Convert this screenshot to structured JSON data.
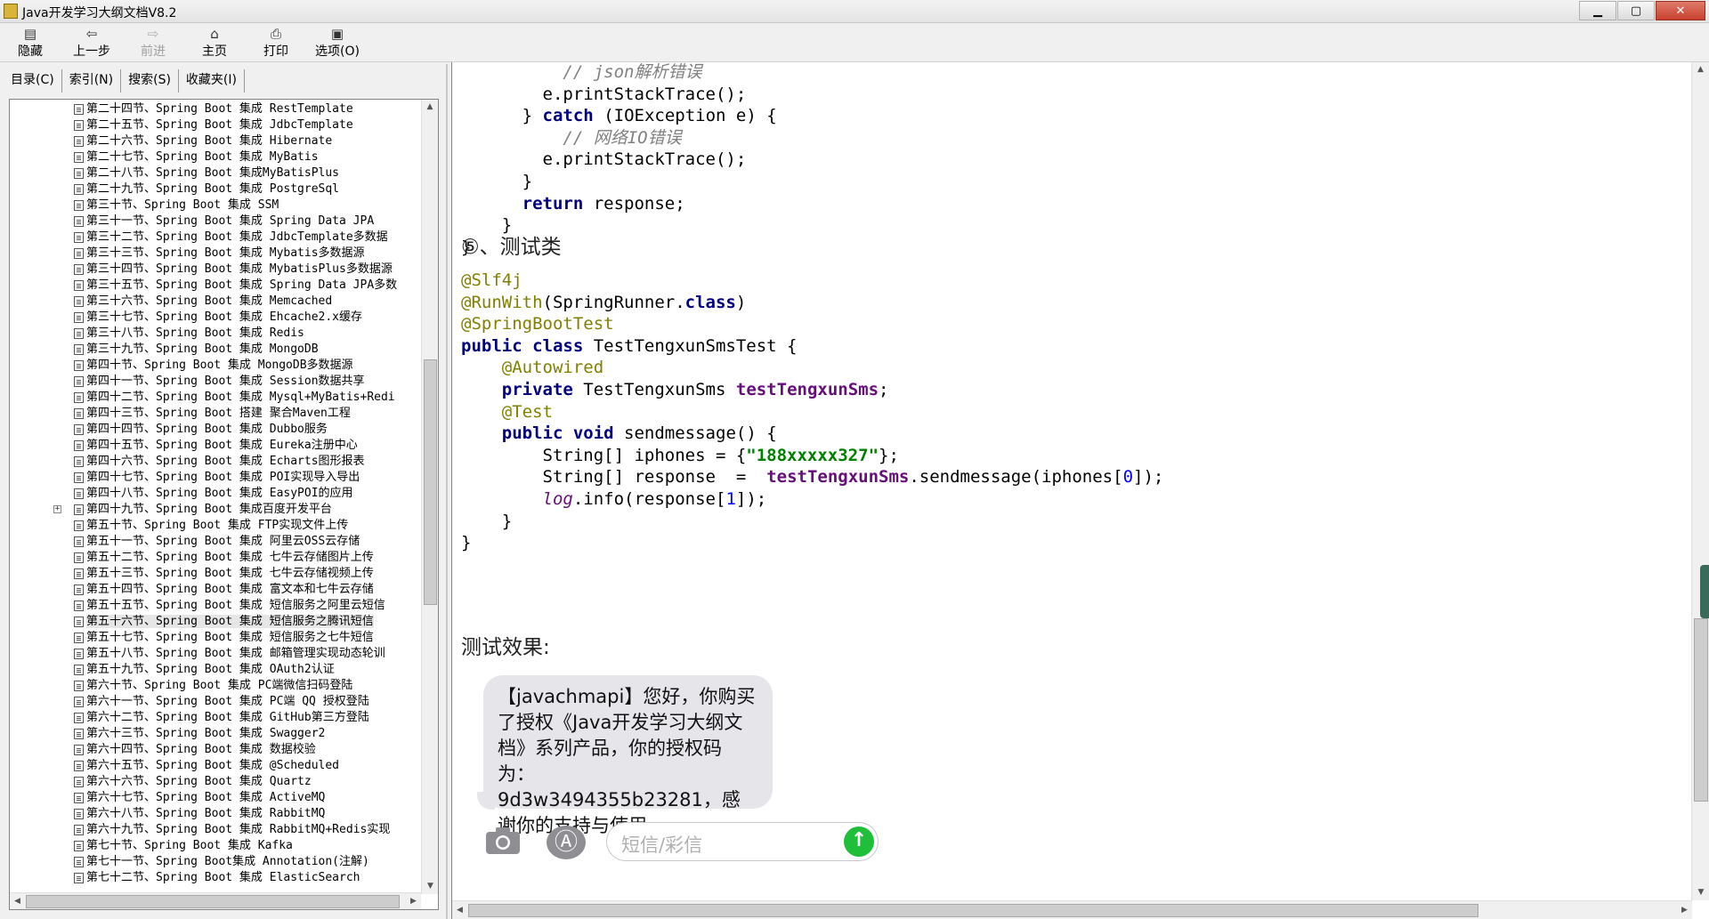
{
  "window": {
    "title": "Java开发学习大纲文档V8.2",
    "minimize": "▁",
    "maximize": "▢",
    "close": "✕"
  },
  "toolbar": {
    "hide": "隐藏",
    "back": "上一步",
    "forward": "前进",
    "home": "主页",
    "print": "打印",
    "options": "选项(O)"
  },
  "tabs": {
    "contents": "目录(C)",
    "index": "索引(N)",
    "search": "搜索(S)",
    "favorites": "收藏夹(I)"
  },
  "tree": {
    "items": [
      "第二十四节、Spring Boot 集成 RestTemplate",
      "第二十五节、Spring Boot 集成 JdbcTemplate",
      "第二十六节、Spring Boot 集成 Hibernate",
      "第二十七节、Spring Boot 集成 MyBatis",
      "第二十八节、Spring Boot 集成MyBatisPlus",
      "第二十九节、Spring Boot 集成 PostgreSql",
      "第三十节、Spring Boot 集成 SSM",
      "第三十一节、Spring Boot 集成 Spring Data JPA",
      "第三十二节、Spring Boot 集成 JdbcTemplate多数据",
      "第三十三节、Spring Boot 集成 Mybatis多数据源",
      "第三十四节、Spring Boot 集成 MybatisPlus多数据源",
      "第三十五节、Spring Boot 集成 Spring Data JPA多数",
      "第三十六节、Spring Boot 集成 Memcached",
      "第三十七节、Spring Boot 集成 Ehcache2.x缓存",
      "第三十八节、Spring Boot 集成 Redis",
      "第三十九节、Spring Boot 集成 MongoDB",
      "第四十节、Spring Boot 集成 MongoDB多数据源",
      "第四十一节、Spring Boot 集成 Session数据共享",
      "第四十二节、Spring Boot 集成 Mysql+MyBatis+Redi",
      "第四十三节、Spring Boot 搭建 聚合Maven工程",
      "第四十四节、Spring Boot 集成 Dubbo服务",
      "第四十五节、Spring Boot 集成 Eureka注册中心",
      "第四十六节、Spring Boot 集成 Echarts图形报表",
      "第四十七节、Spring Boot 集成 POI实现导入导出",
      "第四十八节、Spring Boot 集成 EasyPOI的应用",
      "第四十九节、Spring Boot 集成百度开发平台",
      "第五十节、Spring Boot 集成 FTP实现文件上传",
      "第五十一节、Spring Boot 集成 阿里云OSS云存储",
      "第五十二节、Spring Boot 集成 七牛云存储图片上传",
      "第五十三节、Spring Boot 集成 七牛云存储视频上传",
      "第五十四节、Spring Boot 集成 富文本和七牛云存储",
      "第五十五节、Spring Boot 集成 短信服务之阿里云短信",
      "第五十六节、Spring Boot 集成 短信服务之腾讯短信",
      "第五十七节、Spring Boot 集成 短信服务之七牛短信",
      "第五十八节、Spring Boot 集成 邮箱管理实现动态轮训",
      "第五十九节、Spring Boot 集成 OAuth2认证",
      "第六十节、Spring Boot 集成 PC端微信扫码登陆",
      "第六十一节、Spring Boot 集成 PC端 QQ 授权登陆",
      "第六十二节、Spring Boot 集成 GitHub第三方登陆",
      "第六十三节、Spring Boot 集成 Swagger2",
      "第六十四节、Spring Boot 集成 数据校验",
      "第六十五节、Spring Boot 集成 @Scheduled",
      "第六十六节、Spring Boot 集成 Quartz",
      "第六十七节、Spring Boot 集成 ActiveMQ",
      "第六十八节、Spring Boot 集成 RabbitMQ",
      "第六十九节、Spring Boot 集成 RabbitMQ+Redis实现",
      "第七十节、Spring Boot 集成 Kafka",
      "第七十一节、Spring Boot集成 Annotation(注解)",
      "第七十二节、Spring Boot 集成 ElasticSearch"
    ],
    "selected_index": 32,
    "expander_index": 25,
    "expander_symbol": "+"
  },
  "code1": {
    "comment_json": "// json解析错误",
    "print1": "e.printStackTrace();",
    "catch_close": "}",
    "catch_kw": "catch",
    "catch_rest": " (IOException e) {",
    "comment_io": "// 网络IO错误",
    "print2": "e.printStackTrace();",
    "close1": "}",
    "return_kw": "return",
    "return_rest": " response;",
    "close2": "}",
    "close3": "}"
  },
  "heading5": "⑤、测试类",
  "code2": {
    "ann1": "@Slf4j",
    "ann2": "@RunWith",
    "ann2_rest1": "(SpringRunner.",
    "ann2_class": "class",
    "ann2_rest2": ")",
    "ann3": "@SpringBootTest",
    "decl_kw": "public class",
    "decl_rest": " TestTengxunSmsTest {",
    "autowired": "@Autowired",
    "private_kw": "private",
    "field_type": " TestTengxunSms ",
    "field_name": "testTengxunSms",
    "semi": ";",
    "test_ann": "@Test",
    "method_kw": "public void",
    "method_rest": " sendmessage() {",
    "arr_decl": "String[] iphones = {",
    "arr_val": "\"188xxxxx327\"",
    "arr_end": "};",
    "resp_decl": "String[] response  =  ",
    "resp_call_field": "testTengxunSms",
    "resp_call": ".sendmessage(iphones[",
    "resp_idx": "0",
    "resp_end": "]);",
    "log_field": "log",
    "log_call": ".info(response[",
    "log_idx": "1",
    "log_end": "]);",
    "close_m": "}",
    "close_c": "}"
  },
  "result_heading": "测试效果:",
  "sms": {
    "message": "【javachmapi】您好，你购买了授权《Java开发学习大纲文档》系列产品，你的授权码为：9d3w3494355b23281，感谢你的支持与使用。",
    "input_placeholder": "短信/彩信",
    "appstore_glyph": "Ⓐ",
    "send_glyph": "↑"
  },
  "icons": {
    "camera": "camera-icon",
    "appstore": "appstore-icon",
    "send": "send-arrow-icon"
  }
}
